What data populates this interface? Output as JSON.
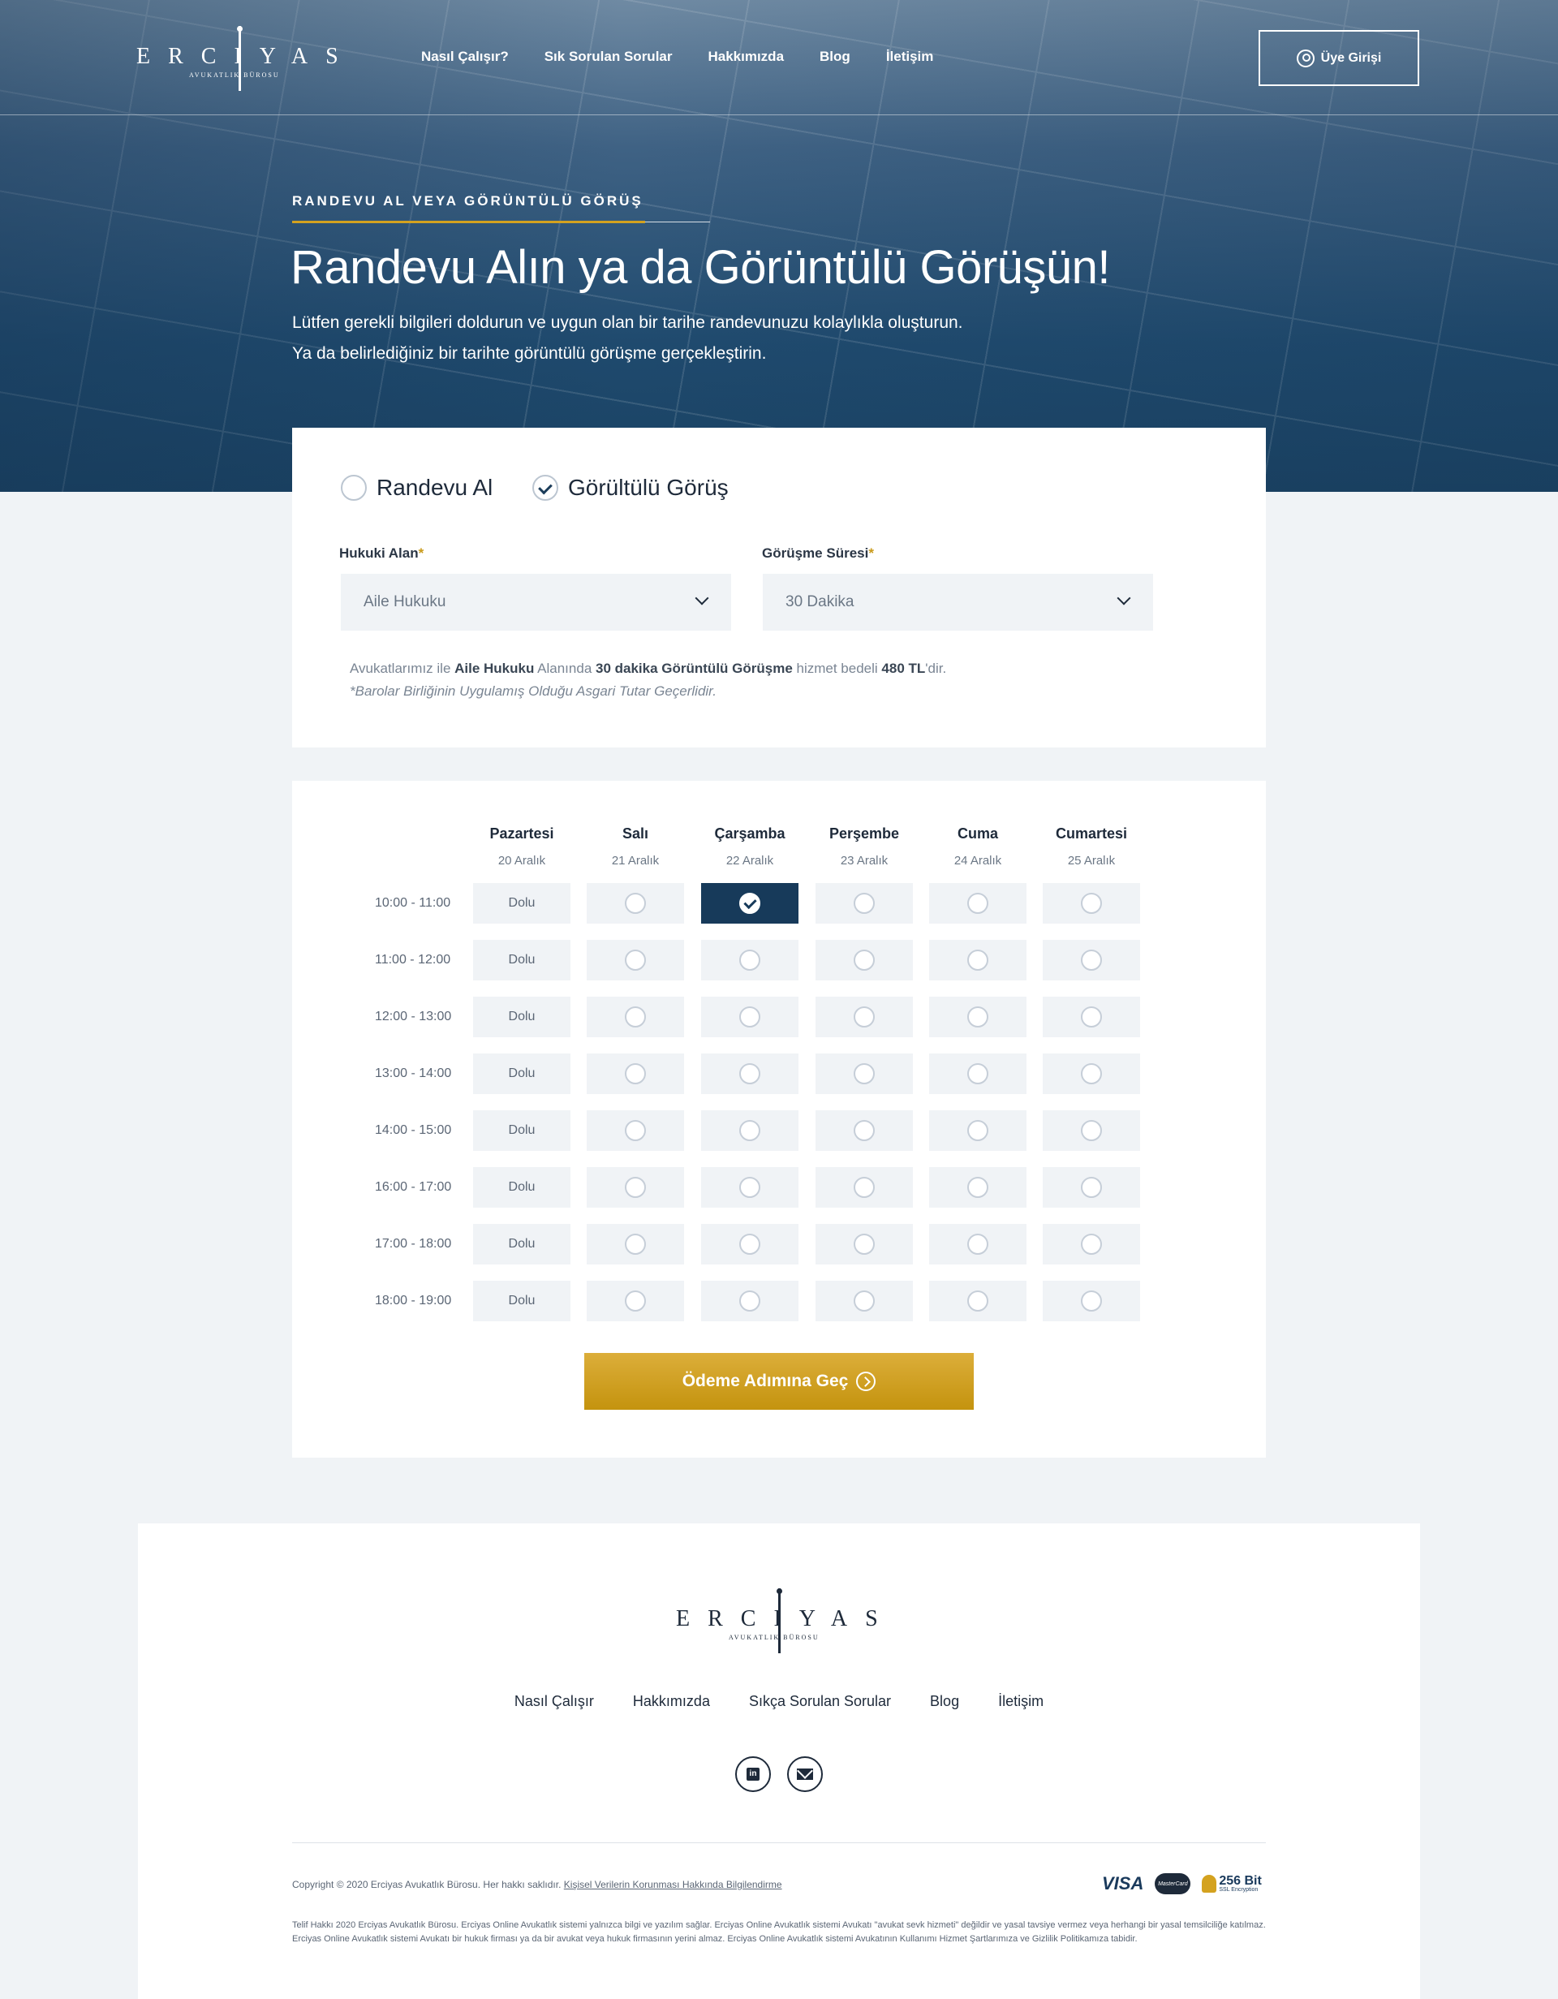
{
  "brand": {
    "logo_text": "ERCIYAS",
    "logo_sub": "AVUKATLIK BÜROSU"
  },
  "nav": {
    "items": [
      "Nasıl Çalışır?",
      "Sık Sorulan Sorular",
      "Hakkımızda",
      "Blog",
      "İletişim"
    ],
    "login": "Üye Girişi"
  },
  "hero": {
    "eyebrow": "RANDEVU AL VEYA GÖRÜNTÜLÜ GÖRÜŞ",
    "title": "Randevu Alın ya da Görüntülü Görüşün!",
    "line1": "Lütfen gerekli bilgileri doldurun ve uygun olan bir tarihe randevunuzu kolaylıkla oluşturun.",
    "line2": "Ya da belirlediğiniz bir tarihte görüntülü görüşme gerçekleştirin."
  },
  "form": {
    "option_appointment": "Randevu Al",
    "option_video": "Görültülü Görüş",
    "selected_option": "video",
    "legal_area_label": "Hukuki Alan",
    "legal_area_value": "Aile Hukuku",
    "duration_label": "Görüşme Süresi",
    "duration_value": "30 Dakika",
    "required_mark": "*",
    "info_t1": "Avukatlarımız ile ",
    "info_area": "Aile Hukuku",
    "info_t2": " Alanında ",
    "info_session": "30 dakika Görüntülü Görüşme",
    "info_t3": " hizmet bedeli ",
    "info_price": "480 TL",
    "info_t4": "'dir.",
    "info_note": "*Barolar Birliğinin Uygulamış Olduğu Asgari Tutar Geçerlidir."
  },
  "schedule": {
    "days": [
      {
        "name": "Pazartesi",
        "date": "20 Aralık"
      },
      {
        "name": "Salı",
        "date": "21 Aralık"
      },
      {
        "name": "Çarşamba",
        "date": "22 Aralık"
      },
      {
        "name": "Perşembe",
        "date": "23 Aralık"
      },
      {
        "name": "Cuma",
        "date": "24 Aralık"
      },
      {
        "name": "Cumartesi",
        "date": "25 Aralık"
      }
    ],
    "times": [
      "10:00 - 11:00",
      "11:00 - 12:00",
      "12:00 - 13:00",
      "13:00 - 14:00",
      "14:00 - 15:00",
      "16:00 - 17:00",
      "17:00 - 18:00",
      "18:00 - 19:00"
    ],
    "full_label": "Dolu",
    "selected": {
      "time": "10:00 - 11:00",
      "day": "Çarşamba"
    },
    "submit": "Ödeme Adımına Geç"
  },
  "footer": {
    "nav": [
      "Nasıl Çalışır",
      "Hakkımızda",
      "Sıkça Sorulan Sorular",
      "Blog",
      "İletişim"
    ],
    "social": [
      "linkedin-icon",
      "mail-icon"
    ],
    "copyright": "Copyright © 2020 Erciyas Avukatlık Bürosu. Her hakkı saklıdır.",
    "privacy_link": "Kişisel Verilerin Korunması Hakkında Bilgilendirme",
    "legal": "Telif Hakkı 2020 Erciyas Avukatlık Bürosu. Erciyas Online Avukatlık sistemi yalnızca bilgi ve yazılım sağlar. Erciyas Online Avukatlık sistemi Avukatı \"avukat sevk hizmeti\" değildir ve yasal tavsiye vermez veya herhangi bir yasal temsilciliğe katılmaz. Erciyas Online Avukatlık sistemi Avukatı bir hukuk firması ya da bir avukat veya hukuk firmasının yerini almaz. Erciyas Online Avukatlık sistemi Avukatının Kullanımı Hizmet Şartlarımıza ve Gizlilik Politikamıza tabidir.",
    "visa": "VISA",
    "mastercard": "MasterCard",
    "ssl_main": "256 Bit",
    "ssl_sub": "SSL Encryption"
  },
  "colors": {
    "navy": "#173a5a",
    "gold": "#d4a21f",
    "background": "#f0f3f6"
  }
}
